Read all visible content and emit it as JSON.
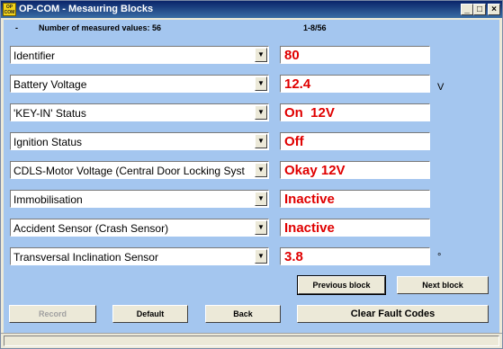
{
  "window": {
    "title": "OP-COM - Mesauring Blocks",
    "app_icon_text": "OP COM",
    "controls": {
      "minimize": "_",
      "maximize": "□",
      "close": "×"
    }
  },
  "header": {
    "dash": "-",
    "count_label": "Number of measured values: 56",
    "range": "1-8/56"
  },
  "rows": [
    {
      "name": "Identifier",
      "value": "80",
      "unit": ""
    },
    {
      "name": "Battery Voltage",
      "value": "12.4",
      "unit": "V"
    },
    {
      "name": "'KEY-IN' Status",
      "value": "On  12V",
      "unit": ""
    },
    {
      "name": "Ignition Status",
      "value": "Off",
      "unit": ""
    },
    {
      "name": "CDLS-Motor Voltage (Central Door Locking Syst",
      "value": "Okay 12V",
      "unit": ""
    },
    {
      "name": "Immobilisation",
      "value": "Inactive",
      "unit": ""
    },
    {
      "name": "Accident Sensor (Crash Sensor)",
      "value": "Inactive",
      "unit": ""
    },
    {
      "name": "Transversal Inclination Sensor",
      "value": "3.8",
      "unit": "°"
    }
  ],
  "buttons": {
    "previous_block": "Previous block",
    "next_block": "Next block",
    "record": "Record",
    "default": "Default",
    "back": "Back",
    "clear_fault_codes": "Clear Fault Codes"
  },
  "colors": {
    "client_background": "#a4c6ef",
    "value_text": "#e00000",
    "titlebar": "#0a246a"
  },
  "icons": {
    "dropdown": "dropdown-arrow-icon"
  }
}
